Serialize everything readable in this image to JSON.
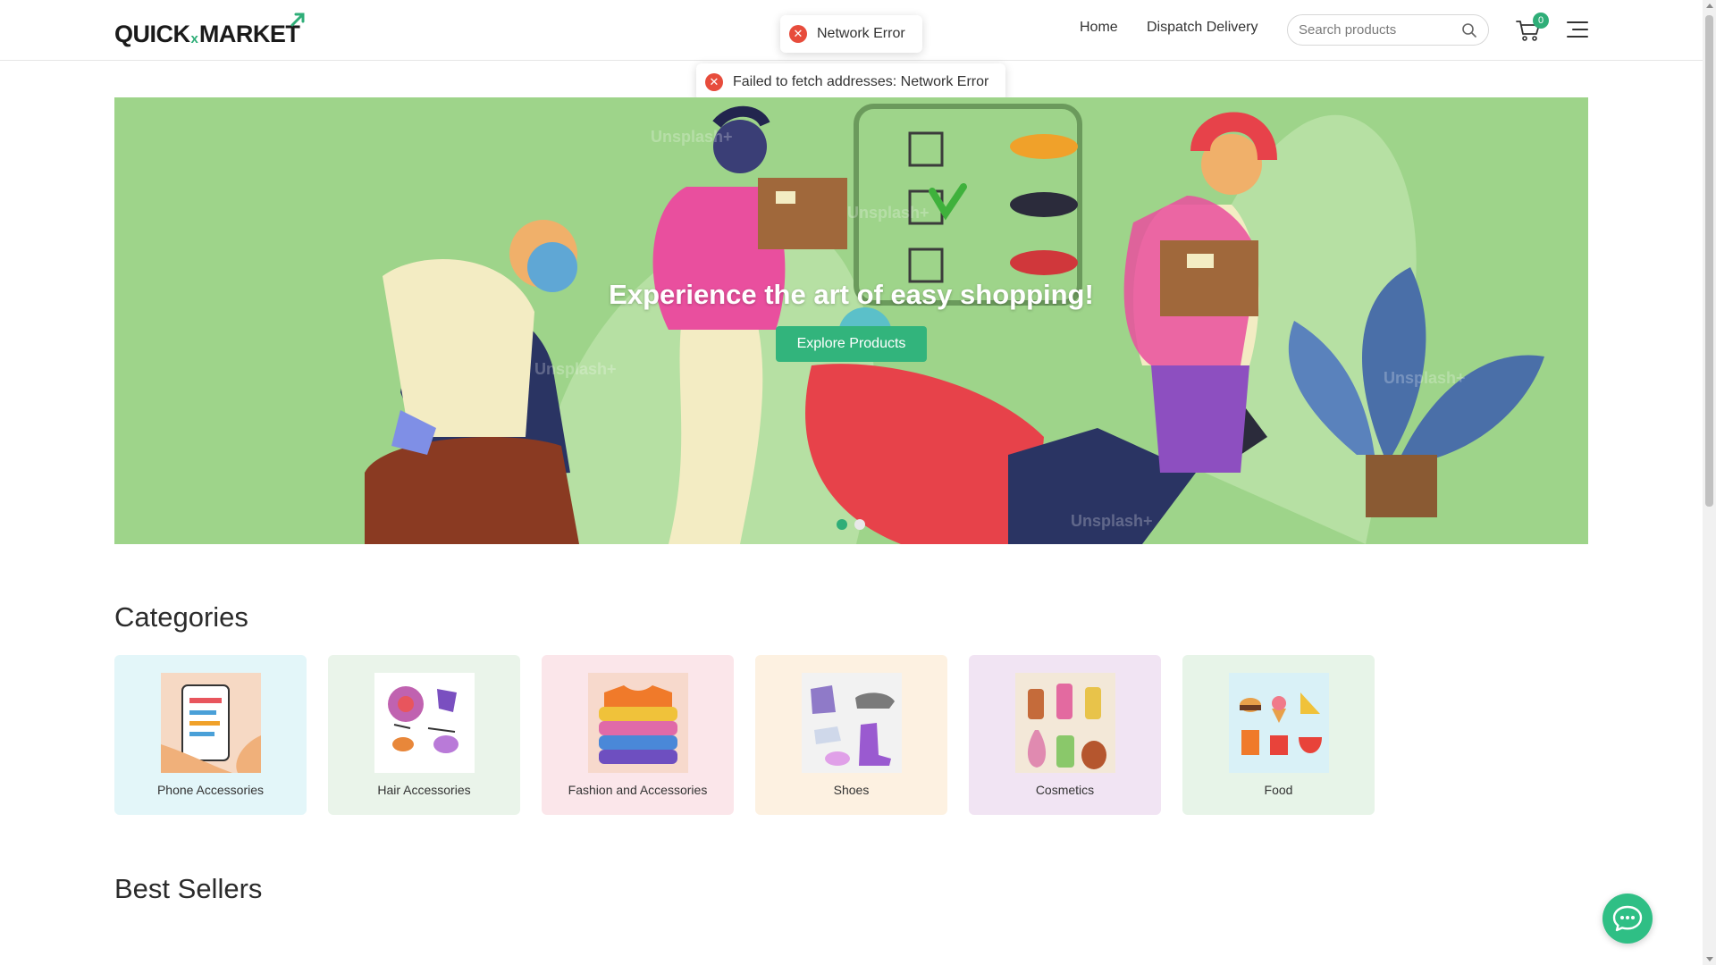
{
  "header": {
    "logo_left": "QUICK",
    "logo_x": "x",
    "logo_right": "MARKET",
    "nav": {
      "home": "Home",
      "dispatch": "Dispatch Delivery"
    },
    "search": {
      "placeholder": "Search products",
      "value": ""
    },
    "cart_count": "0"
  },
  "toasts": [
    {
      "message": "Network Error"
    },
    {
      "message": "Failed to fetch addresses: Network Error"
    }
  ],
  "hero": {
    "title": "Experience the art of easy shopping!",
    "button_label": "Explore Products",
    "slide_count": 2,
    "active_slide": 1
  },
  "categories": {
    "title": "Categories",
    "items": [
      {
        "label": "Phone Accessories",
        "bg": "#e3f6f9"
      },
      {
        "label": "Hair Accessories",
        "bg": "#eaf4ea"
      },
      {
        "label": "Fashion and Accessories",
        "bg": "#fbe6ea"
      },
      {
        "label": "Shoes",
        "bg": "#fdf1e1"
      },
      {
        "label": "Cosmetics",
        "bg": "#f1e4f3"
      },
      {
        "label": "Food",
        "bg": "#e7f4e8"
      }
    ]
  },
  "best_sellers": {
    "title": "Best Sellers"
  },
  "colors": {
    "accent": "#2fae78",
    "error": "#e74c3c",
    "hero_bg": "#9ed48a"
  }
}
